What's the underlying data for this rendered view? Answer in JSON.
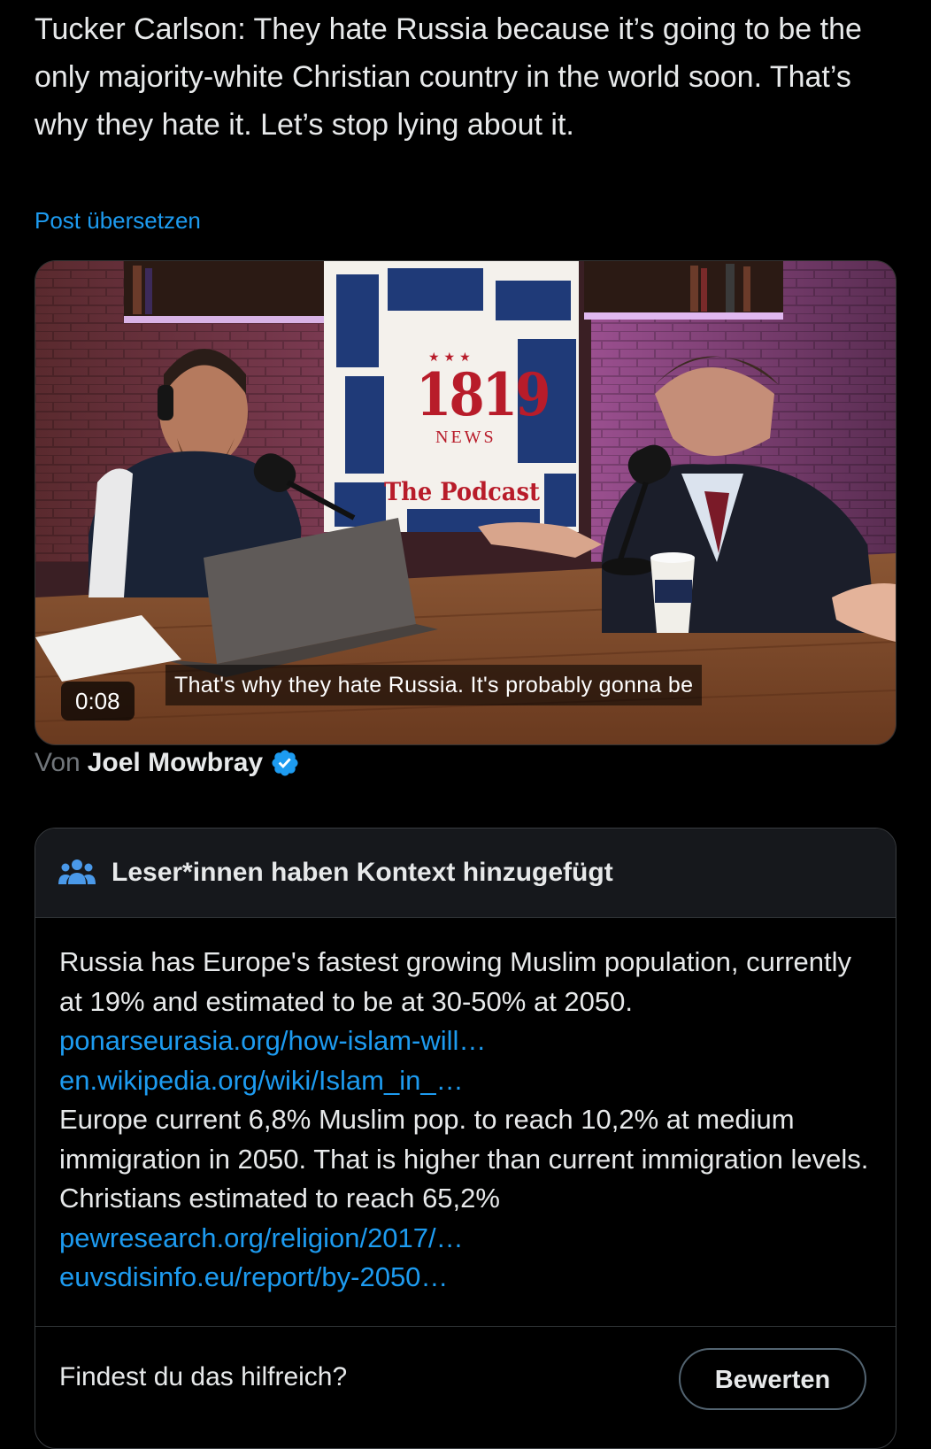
{
  "tweet": {
    "text": "Tucker Carlson: They hate Russia because it’s going to be the only majority-white Christian country in the world soon. That’s why they hate it. Let’s stop lying about it.",
    "translate_label": "Post übersetzen"
  },
  "video": {
    "caption": "That's why they hate Russia. It's probably gonna be",
    "timestamp": "0:08",
    "logo_stars": "★★★",
    "logo_number": "1819",
    "logo_news": "NEWS",
    "logo_podcast": "The Podcast"
  },
  "byline": {
    "prefix": "Von",
    "name": "Joel Mowbray"
  },
  "note": {
    "title": "Leser*innen haben Kontext hinzugefügt",
    "paragraph1": "Russia has Europe's fastest growing Muslim population, currently at 19% and estimated to be at 30-50% at 2050.",
    "links1": [
      "ponarseurasia.org/how-islam-will…",
      "en.wikipedia.org/wiki/Islam_in_…"
    ],
    "paragraph2": "Europe current 6,8% Muslim pop. to reach 10,2% at medium immigration in 2050. That is higher than current immigration levels. Christians estimated to reach 65,2%",
    "links2": [
      "pewresearch.org/religion/2017/…",
      "euvsdisinfo.eu/report/by-2050…"
    ],
    "helpful_question": "Findest du das hilfreich?",
    "rate_label": "Bewerten"
  },
  "colors": {
    "link": "#1d9bf0",
    "verified_badge": "#1d9bf0",
    "note_header_bg": "#16181c",
    "brand_red": "#b81c2a"
  },
  "icons": {
    "verified": "verified-badge-icon",
    "note_header": "people-group-icon"
  }
}
